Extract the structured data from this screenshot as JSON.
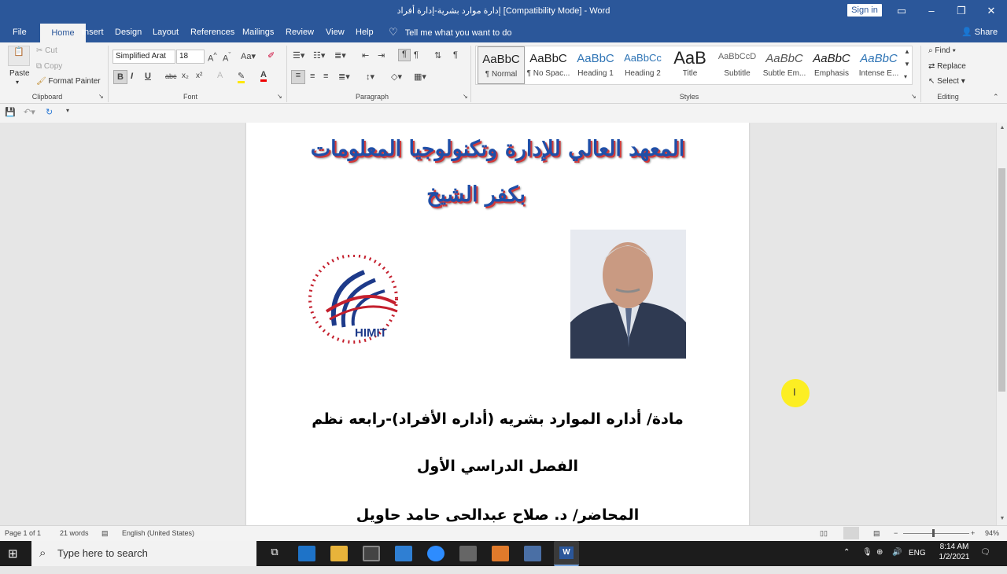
{
  "window": {
    "title": "إدارة موارد بشرية-إدارة أفراد [Compatibility Mode]  -  Word",
    "signin_label": "Sign in",
    "minimize": "–",
    "restore": "❐",
    "close": "✕"
  },
  "tabs": [
    "File",
    "Home",
    "Insert",
    "Design",
    "Layout",
    "References",
    "Mailings",
    "Review",
    "View",
    "Help"
  ],
  "tell_me": "Tell me what you want to do",
  "share_label": "Share",
  "clipboard": {
    "paste": "Paste",
    "cut": "Cut",
    "copy": "Copy",
    "format_painter": "Format Painter",
    "group": "Clipboard"
  },
  "font": {
    "name": "Simplified Arat",
    "size": "18",
    "group": "Font",
    "bold": "B",
    "italic": "I",
    "underline": "U",
    "strike": "abc",
    "subscript": "x₂",
    "superscript": "x²"
  },
  "paragraph": {
    "group": "Paragraph"
  },
  "styles": {
    "group": "Styles",
    "items": [
      {
        "preview": "AaBbC",
        "name": "¶ Normal"
      },
      {
        "preview": "AaBbC",
        "name": "¶ No Spac..."
      },
      {
        "preview": "AaBbC",
        "name": "Heading 1"
      },
      {
        "preview": "AaBbCc",
        "name": "Heading 2"
      },
      {
        "preview": "AaB",
        "name": "Title"
      },
      {
        "preview": "AaBbCcD",
        "name": "Subtitle"
      },
      {
        "preview": "AaBbC",
        "name": "Subtle Em..."
      },
      {
        "preview": "AaBbC",
        "name": "Emphasis"
      },
      {
        "preview": "AaBbC",
        "name": "Intense E..."
      }
    ]
  },
  "editing": {
    "find": "Find",
    "replace": "Replace",
    "select": "Select",
    "group": "Editing"
  },
  "document": {
    "heading_line1": "المعهد العالي للإدارة وتكنولوجيا المعلومات",
    "heading_line2": "بكفر الشيخ",
    "logo_text": "HIMIT",
    "subject": "مادة/ أداره الموارد بشريه (أداره الأفراد)-رابعه نظم",
    "semester": "الفصل الدراسي الأول",
    "lecturer": "المحاضر/ د. صلاح عبدالحى حامد حاويل"
  },
  "status": {
    "page": "Page 1 of 1",
    "words": "21 words",
    "language": "English (United States)",
    "zoom": "94%"
  },
  "taskbar": {
    "search_placeholder": "Type here to search",
    "lang": "ENG",
    "time": "8:14 AM",
    "date": "1/2/2021"
  }
}
